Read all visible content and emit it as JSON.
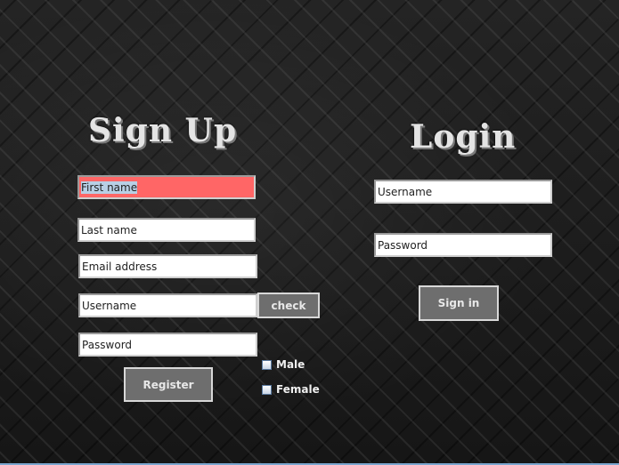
{
  "signup": {
    "title": "Sign Up",
    "first_name": "First name",
    "last_name": "Last name",
    "email": "Email address",
    "username": "Username",
    "check_label": "check",
    "password": "Password",
    "register_label": "Register",
    "male_label": "Male",
    "female_label": "Female"
  },
  "login": {
    "title": "Login",
    "username": "Username",
    "password": "Password",
    "signin_label": "Sign in"
  },
  "colors": {
    "active_field": "#ff6666",
    "button_bg": "#6e6e6e"
  }
}
